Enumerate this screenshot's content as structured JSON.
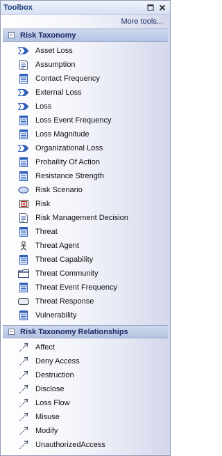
{
  "window": {
    "title": "Toolbox",
    "pin_icon": "restore-icon",
    "close_icon": "close-icon"
  },
  "more_tools": "More tools...",
  "groups": [
    {
      "label": "Risk Taxonomy",
      "expanded_symbol": "−",
      "items": [
        {
          "label": "Asset Loss",
          "icon": "event-arrow-icon"
        },
        {
          "label": "Assumption",
          "icon": "document-icon"
        },
        {
          "label": "Contact Frequency",
          "icon": "block-icon"
        },
        {
          "label": "External Loss",
          "icon": "event-arrow-icon"
        },
        {
          "label": "Loss",
          "icon": "event-arrow-icon"
        },
        {
          "label": "Loss Event Frequency",
          "icon": "block-icon"
        },
        {
          "label": "Loss Magnitude",
          "icon": "block-icon"
        },
        {
          "label": "Organizational Loss",
          "icon": "event-arrow-icon"
        },
        {
          "label": "Probaility Of Action",
          "icon": "block-icon"
        },
        {
          "label": "Resistance Strength",
          "icon": "block-icon"
        },
        {
          "label": "Risk Scenario",
          "icon": "ellipse-icon"
        },
        {
          "label": "Risk",
          "icon": "requirement-icon"
        },
        {
          "label": "Risk Management Decision",
          "icon": "document-icon"
        },
        {
          "label": "Threat",
          "icon": "block-icon"
        },
        {
          "label": "Threat Agent",
          "icon": "actor-icon"
        },
        {
          "label": "Threat Capability",
          "icon": "block-icon"
        },
        {
          "label": "Threat Community",
          "icon": "folder-icon"
        },
        {
          "label": "Threat Event Frequency",
          "icon": "block-icon"
        },
        {
          "label": "Threat Response",
          "icon": "rounded-rect-icon"
        },
        {
          "label": "Vulnerability",
          "icon": "block-icon"
        }
      ]
    },
    {
      "label": "Risk Taxonomy Relationships",
      "expanded_symbol": "−",
      "items": [
        {
          "label": "Affect",
          "icon": "dashed-arrow-icon"
        },
        {
          "label": "Deny Access",
          "icon": "dashed-arrow-icon"
        },
        {
          "label": "Destruction",
          "icon": "dashed-arrow-icon"
        },
        {
          "label": "Disclose",
          "icon": "dashed-arrow-icon"
        },
        {
          "label": "Loss Flow",
          "icon": "dashed-arrow-icon"
        },
        {
          "label": "Misuse",
          "icon": "dashed-arrow-icon"
        },
        {
          "label": "Modify",
          "icon": "dashed-arrow-icon"
        },
        {
          "label": "UnauthorizedAccess",
          "icon": "dashed-arrow-icon"
        }
      ]
    }
  ],
  "colors": {
    "title": "#1b3f7a",
    "group_header": "#b3c3e2",
    "icon_blue": "#2f5fb8"
  }
}
